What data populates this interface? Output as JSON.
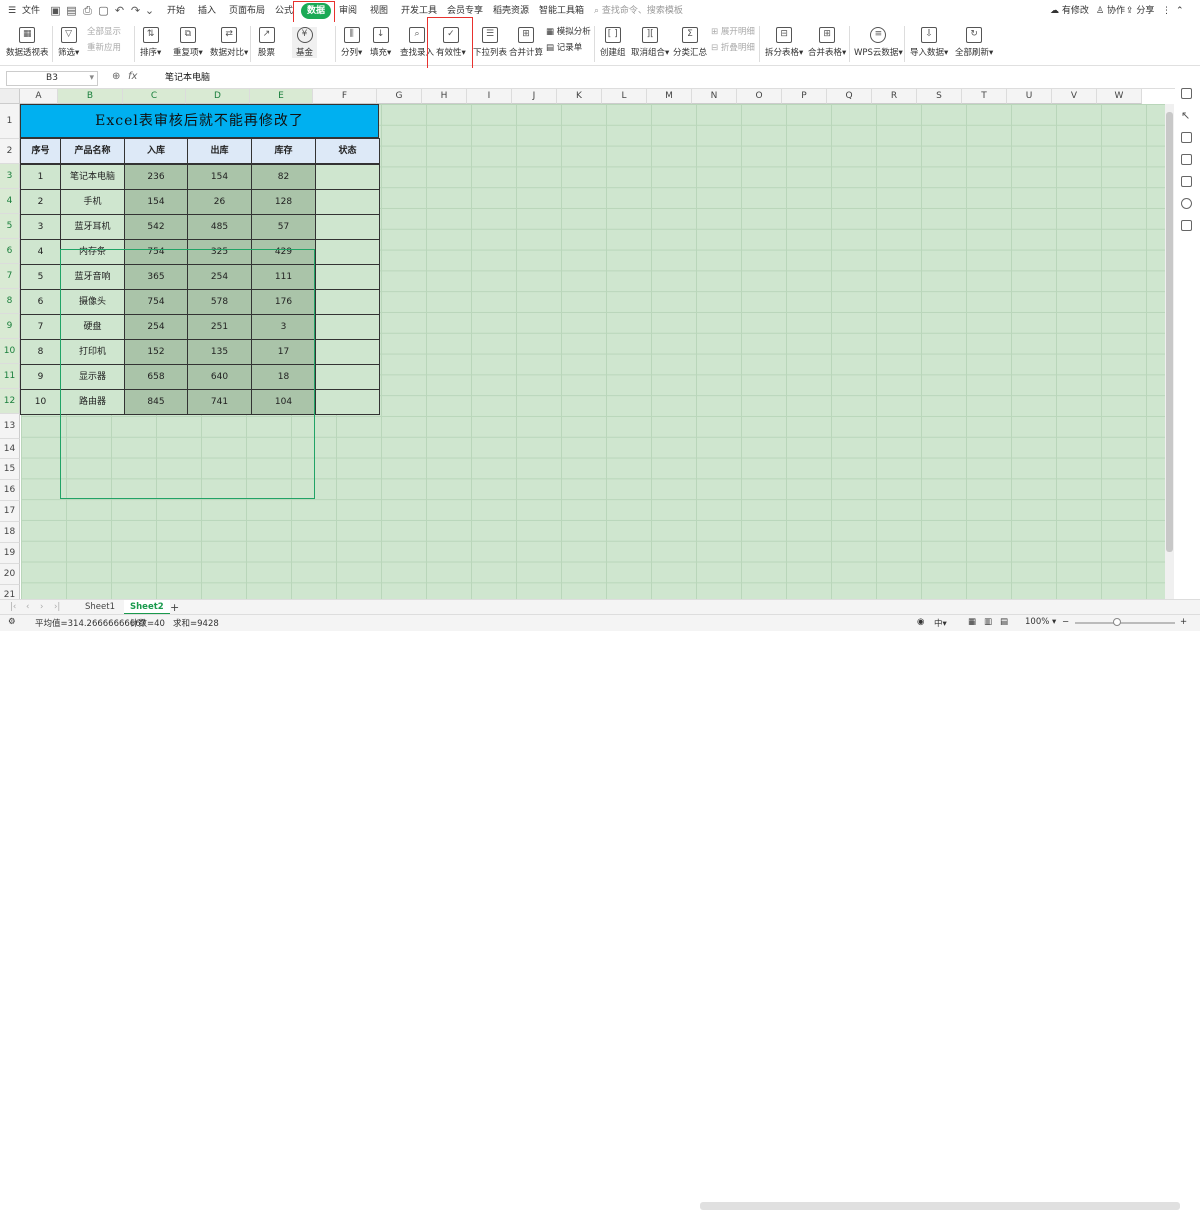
{
  "menubar": {
    "file": "文件",
    "tabs": [
      "开始",
      "插入",
      "页面布局",
      "公式",
      "数据",
      "审阅",
      "视图",
      "开发工具",
      "会员专享",
      "稻壳资源",
      "智能工具箱"
    ],
    "active_tab": "数据",
    "search_placeholder": "查找命令、搜索模板",
    "right": {
      "modify": "有修改",
      "collab": "协作",
      "share": "分享"
    }
  },
  "ribbon": {
    "pivot": "数据透视表",
    "filter": "筛选",
    "show_all": "全部显示",
    "reapply": "重新应用",
    "sort": "排序",
    "duplicates": "重复项",
    "compare": "数据对比",
    "stock": "股票",
    "fund": "基金",
    "split_col": "分列",
    "fill": "填充",
    "lookup_entry": "查找录入",
    "validity": "有效性",
    "dropdown_list": "下拉列表",
    "consolidate": "合并计算",
    "what_if": "模拟分析",
    "record_form": "记录单",
    "group": "创建组",
    "ungroup": "取消组合",
    "subtotal": "分类汇总",
    "expand_detail": "展开明细",
    "collapse_detail": "折叠明细",
    "split_table": "拆分表格",
    "merge_table": "合并表格",
    "wps_cloud": "WPS云数据",
    "import_data": "导入数据",
    "refresh_all": "全部刷新"
  },
  "formula_bar": {
    "name_box": "B3",
    "fx": "fx",
    "value": "笔记本电脑"
  },
  "columns": [
    "A",
    "B",
    "C",
    "D",
    "E",
    "F",
    "G",
    "H",
    "I",
    "J",
    "K",
    "L",
    "M",
    "N",
    "O",
    "P",
    "Q",
    "R",
    "S",
    "T",
    "U",
    "V",
    "W"
  ],
  "rows": [
    "1",
    "2",
    "3",
    "4",
    "5",
    "6",
    "7",
    "8",
    "9",
    "10",
    "11",
    "12",
    "13",
    "14",
    "15",
    "16",
    "17",
    "18",
    "19",
    "20",
    "21"
  ],
  "sheet": {
    "title": "Excel表审核后就不能再修改了",
    "headers": [
      "序号",
      "产品名称",
      "入库",
      "出库",
      "库存",
      "状态"
    ],
    "data": [
      [
        "1",
        "笔记本电脑",
        "236",
        "154",
        "82",
        ""
      ],
      [
        "2",
        "手机",
        "154",
        "26",
        "128",
        ""
      ],
      [
        "3",
        "蓝牙耳机",
        "542",
        "485",
        "57",
        ""
      ],
      [
        "4",
        "内存条",
        "754",
        "325",
        "429",
        ""
      ],
      [
        "5",
        "蓝牙音响",
        "365",
        "254",
        "111",
        ""
      ],
      [
        "6",
        "摄像头",
        "754",
        "578",
        "176",
        ""
      ],
      [
        "7",
        "硬盘",
        "254",
        "251",
        "3",
        ""
      ],
      [
        "8",
        "打印机",
        "152",
        "135",
        "17",
        ""
      ],
      [
        "9",
        "显示器",
        "658",
        "640",
        "18",
        ""
      ],
      [
        "10",
        "路由器",
        "845",
        "741",
        "104",
        ""
      ]
    ]
  },
  "sheet_tabs": [
    "Sheet1",
    "Sheet2"
  ],
  "active_sheet": "Sheet2",
  "status": {
    "average": "平均值=314.26666666667",
    "count": "计数=40",
    "sum": "求和=9428",
    "zoom": "100%"
  },
  "colors": {
    "accent": "#1aaa55",
    "title_fill": "#00b0f0",
    "header_fill": "#dde9f7",
    "sheet_bg": "#cfe6cf",
    "highlight": "#e8322e"
  }
}
